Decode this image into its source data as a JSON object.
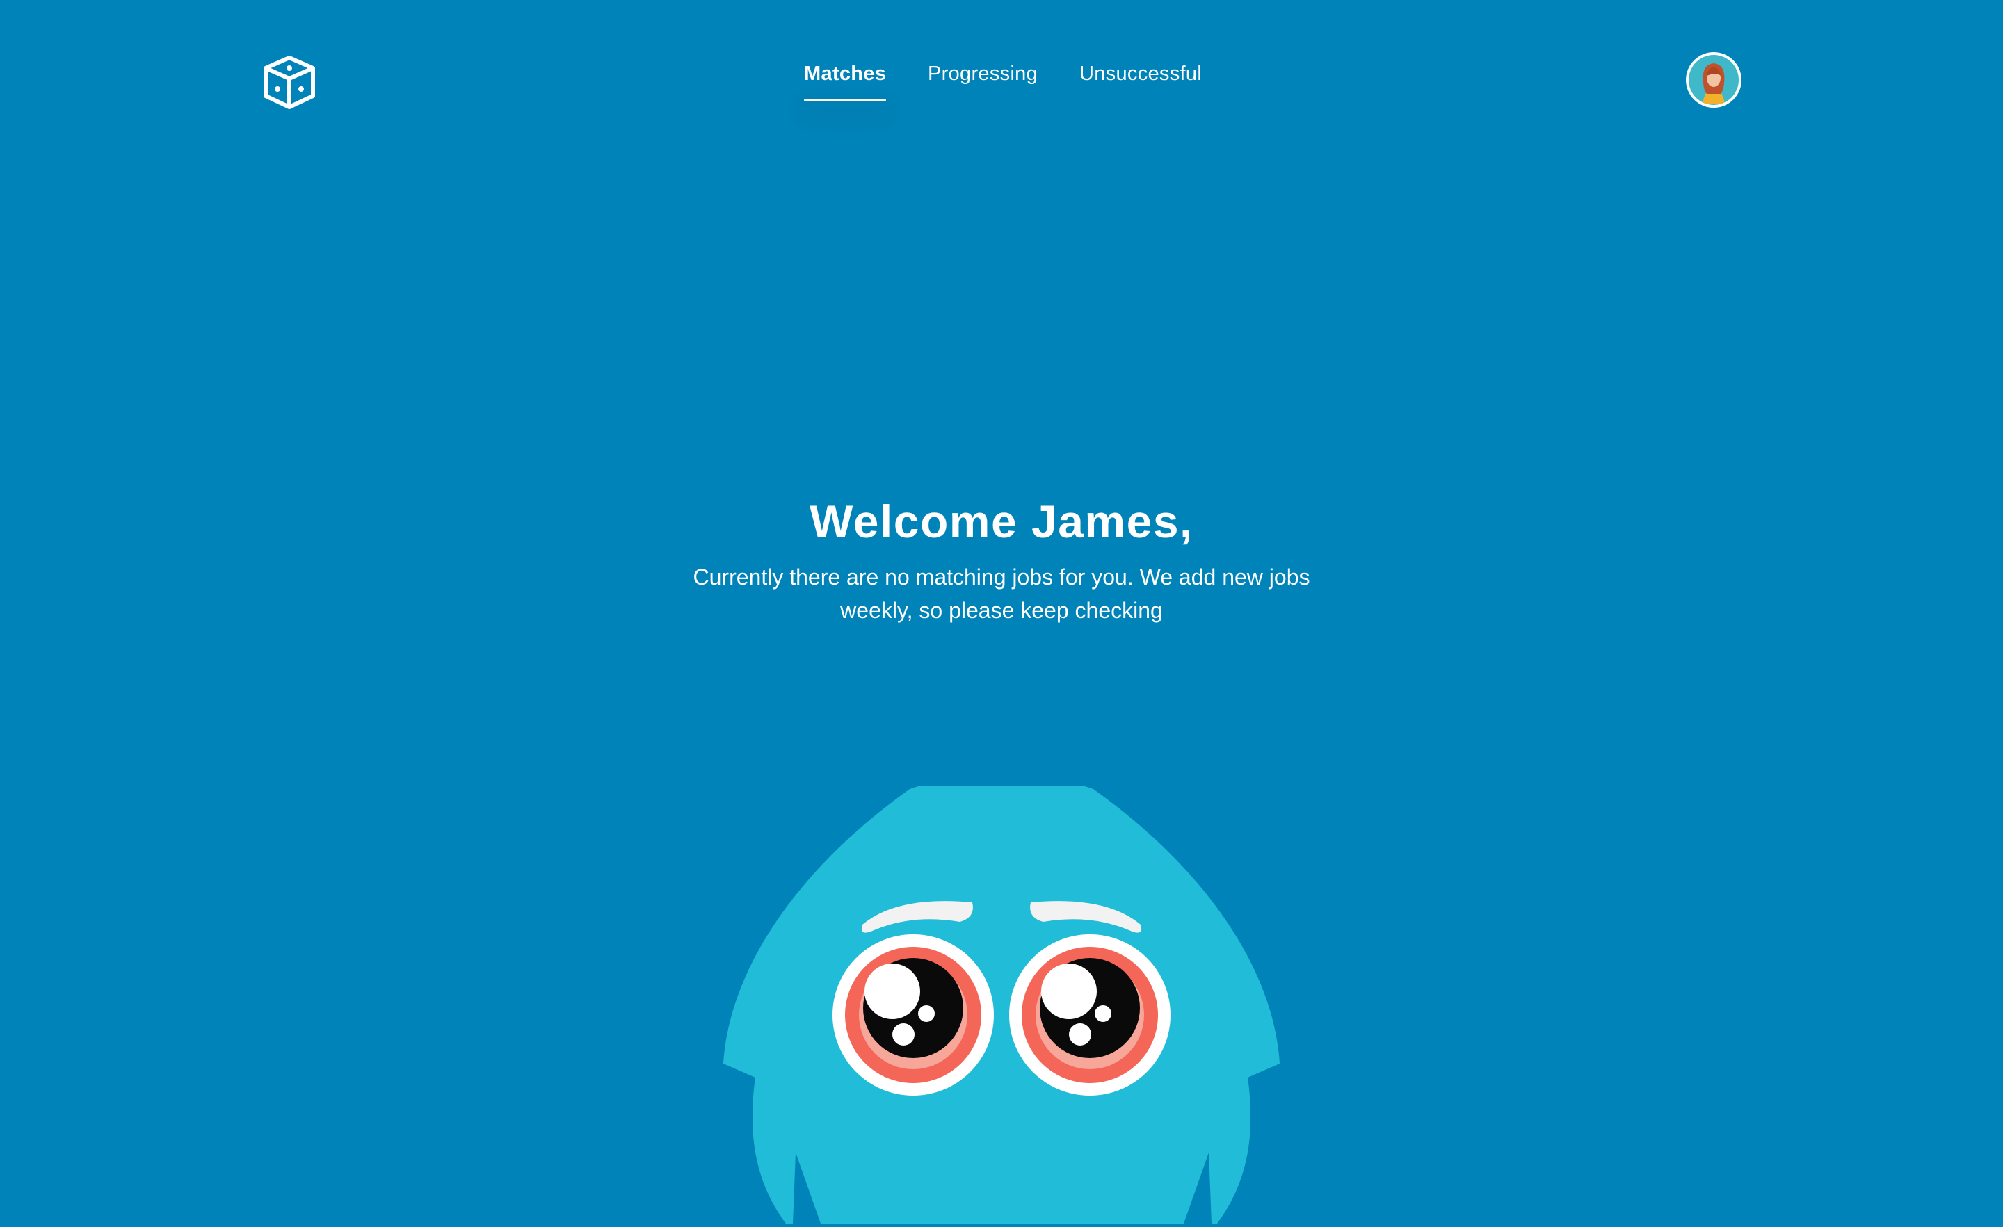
{
  "header": {
    "logo_icon": "dice-cube-icon",
    "nav": {
      "matches_label": "Matches",
      "progressing_label": "Progressing",
      "unsuccessful_label": "Unsuccessful",
      "active": "Matches"
    },
    "avatar_icon": "user-avatar"
  },
  "main": {
    "title": "Welcome  James,",
    "message": "Currently there are no matching jobs for you. We add new jobs weekly, so please keep checking",
    "illustration": "blue-monster-illustration"
  },
  "colors": {
    "background": "#0083B8",
    "monster_body": "#21BCD7",
    "eye_ring": "#F46658",
    "brow": "#F2F2F2"
  }
}
